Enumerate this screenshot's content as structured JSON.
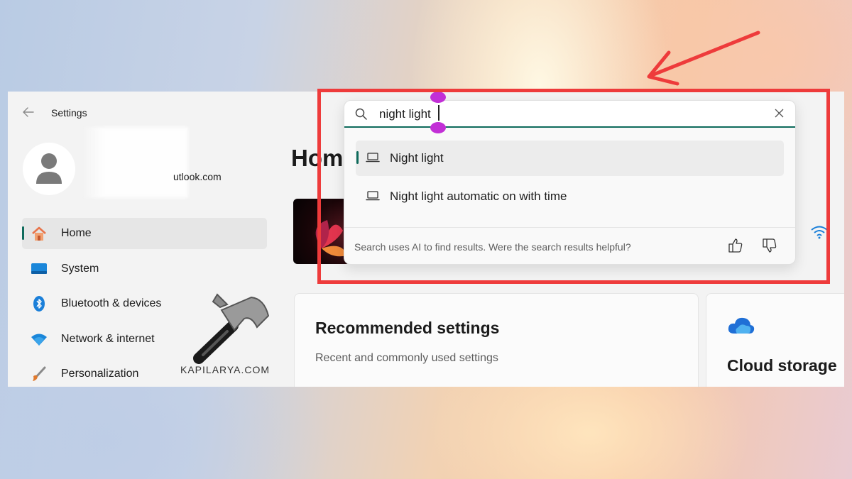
{
  "window": {
    "title": "Settings"
  },
  "user": {
    "email": "utlook.com"
  },
  "nav": {
    "items": [
      {
        "label": "Home",
        "icon": "home-icon"
      },
      {
        "label": "System",
        "icon": "system-icon"
      },
      {
        "label": "Bluetooth & devices",
        "icon": "bluetooth-icon"
      },
      {
        "label": "Network & internet",
        "icon": "network-icon"
      },
      {
        "label": "Personalization",
        "icon": "personalization-icon"
      }
    ]
  },
  "main": {
    "heading": "Home",
    "cards": {
      "recommended": {
        "title": "Recommended settings",
        "subtitle": "Recent and commonly used settings"
      },
      "cloud": {
        "title": "Cloud storage"
      }
    }
  },
  "search": {
    "value": "night light",
    "results": [
      {
        "label": "Night light",
        "icon": "laptop-icon"
      },
      {
        "label": "Night light automatic on with time",
        "icon": "laptop-icon"
      }
    ],
    "footer": "Search uses AI to find results. Were the search results helpful?"
  },
  "watermark": {
    "text": "KAPILARYA.COM"
  },
  "colors": {
    "accent": "#0f6b5c",
    "highlight": "#ee3b3b",
    "handle": "#c22fd6"
  }
}
